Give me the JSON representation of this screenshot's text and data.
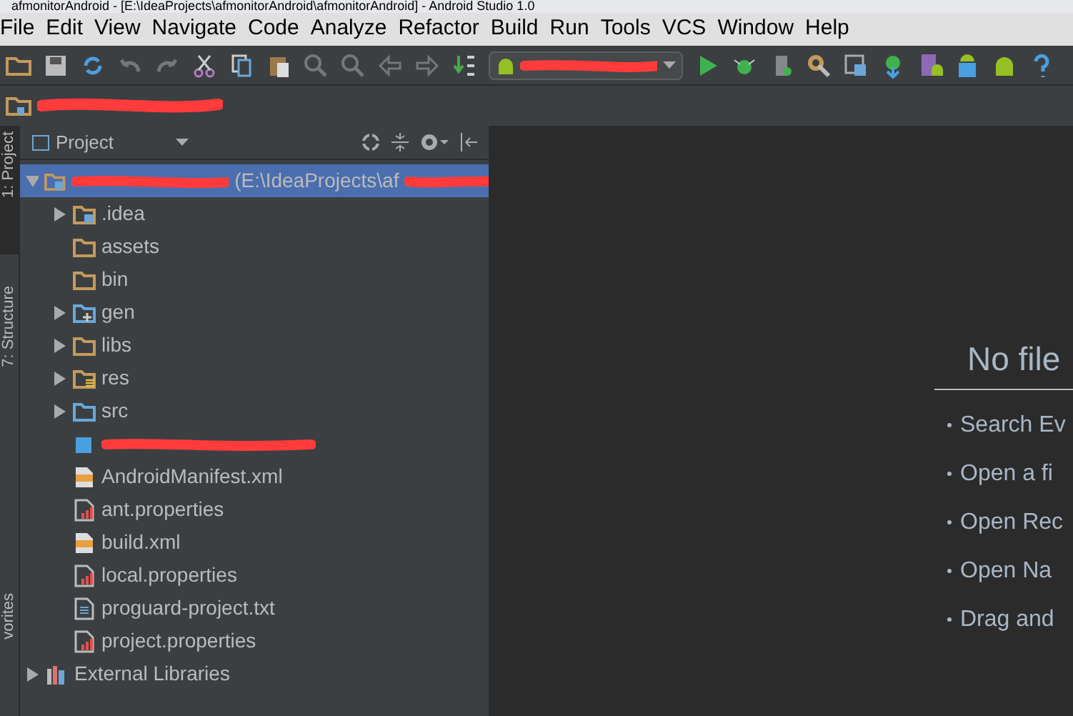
{
  "window": {
    "title": "afmonitorAndroid - [E:\\IdeaProjects\\afmonitorAndroid\\afmonitorAndroid] - Android Studio 1.0"
  },
  "menu": [
    "File",
    "Edit",
    "View",
    "Navigate",
    "Code",
    "Analyze",
    "Refactor",
    "Build",
    "Run",
    "Tools",
    "VCS",
    "Window",
    "Help"
  ],
  "side_tabs": [
    {
      "label": "1: Project",
      "selected": true
    },
    {
      "label": "7: Structure",
      "selected": false
    },
    {
      "label": "vorites",
      "selected": false
    }
  ],
  "project_panel": {
    "view": "Project",
    "tree": [
      {
        "label": "(E:\\IdeaProjects\\af",
        "kind": "module",
        "expanded": true,
        "selected": true,
        "children": [
          {
            "label": ".idea",
            "kind": "module",
            "expanded": false,
            "selected": false
          },
          {
            "label": "assets",
            "kind": "folder",
            "selected": false
          },
          {
            "label": "bin",
            "kind": "folder",
            "selected": false
          },
          {
            "label": "gen",
            "kind": "gen",
            "expanded": false,
            "selected": false
          },
          {
            "label": "libs",
            "kind": "folder",
            "expanded": false,
            "selected": false
          },
          {
            "label": "res",
            "kind": "res",
            "expanded": false,
            "selected": false
          },
          {
            "label": "src",
            "kind": "src",
            "expanded": false,
            "selected": false
          },
          {
            "kind": "redacted",
            "selected": false
          },
          {
            "label": "AndroidManifest.xml",
            "kind": "xml",
            "selected": false
          },
          {
            "label": "ant.properties",
            "kind": "properties",
            "selected": false
          },
          {
            "label": "build.xml",
            "kind": "xml",
            "selected": false
          },
          {
            "label": "local.properties",
            "kind": "properties",
            "selected": false
          },
          {
            "label": "proguard-project.txt",
            "kind": "text",
            "selected": false
          },
          {
            "label": "project.properties",
            "kind": "properties",
            "selected": false
          }
        ]
      },
      {
        "label": "External Libraries",
        "kind": "libraries",
        "expanded": false,
        "selected": false
      }
    ]
  },
  "editor": {
    "heading": "No file",
    "tips": [
      "Search Ev",
      "Open a fi",
      "Open Rec",
      "Open Na",
      "Drag and"
    ]
  }
}
